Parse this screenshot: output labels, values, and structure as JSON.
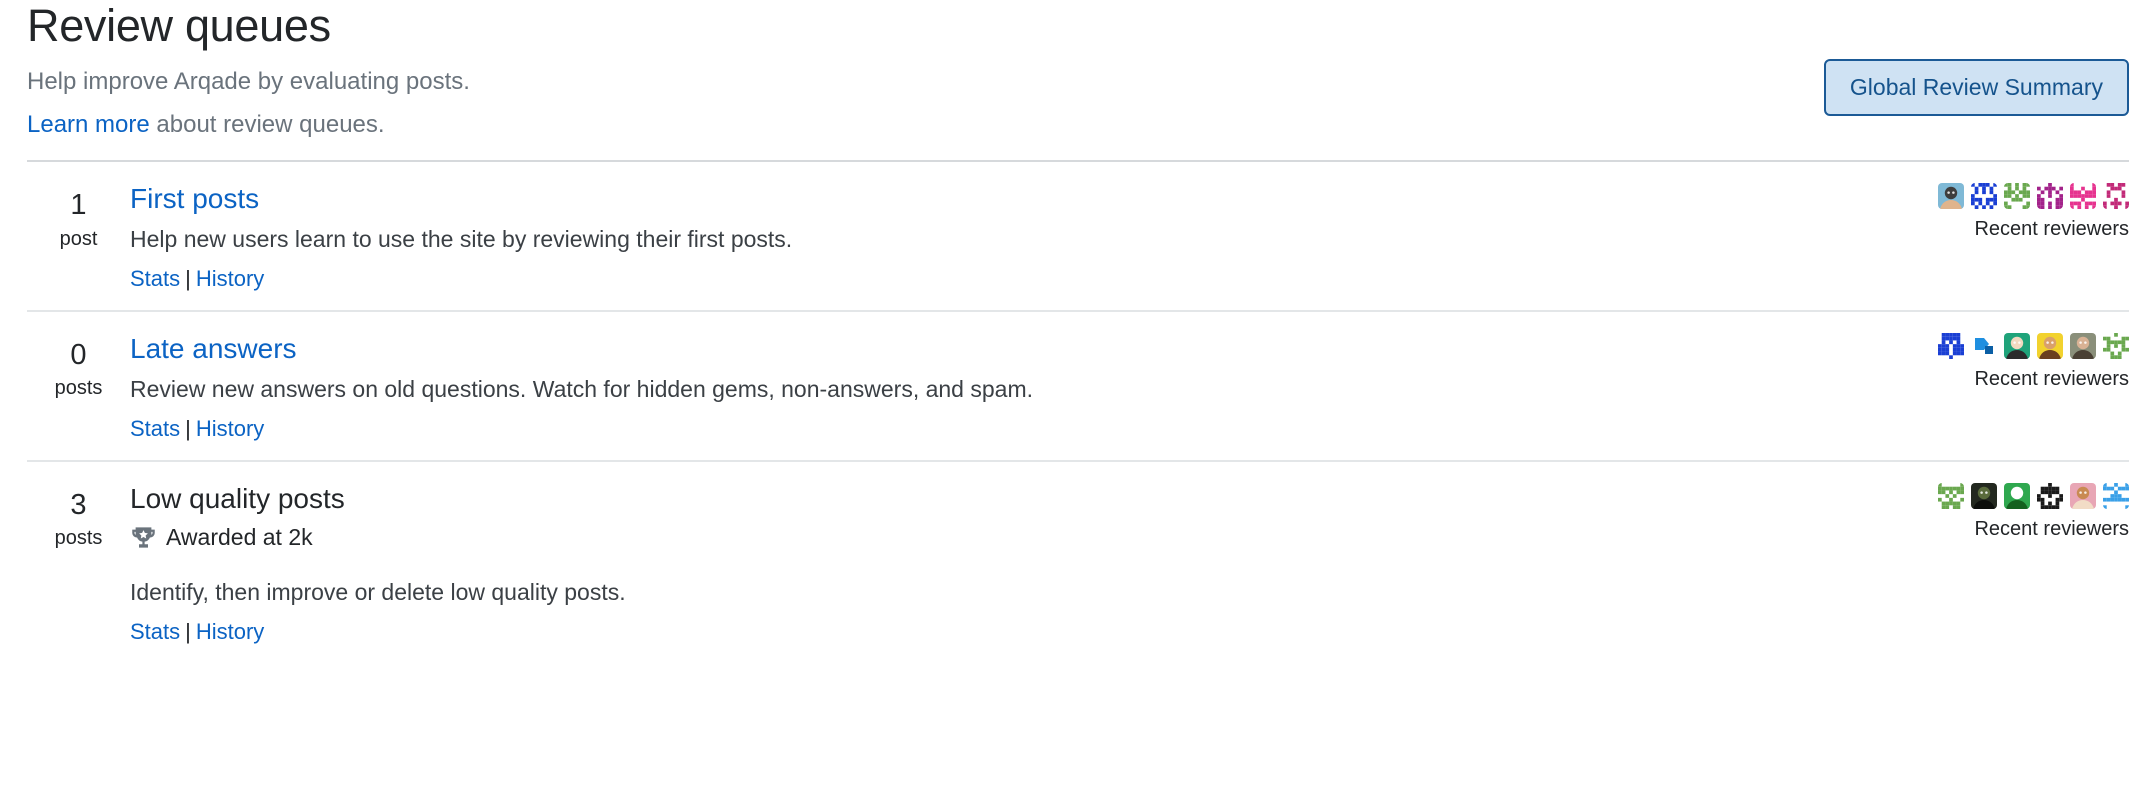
{
  "header": {
    "title": "Review queues",
    "subtitle": "Help improve Arqade by evaluating posts.",
    "learn_more_link": "Learn more",
    "learn_more_rest": " about review queues.",
    "summary_button": "Global Review Summary"
  },
  "colors": {
    "link_blue": "#0b63c4",
    "button_bg": "#cfe2f3",
    "button_border": "#1b5a96",
    "button_text": "#15538c",
    "muted_text": "#6a737c",
    "body_text": "#232629",
    "divider": "#d6d9dc",
    "trophy": "#6a737c"
  },
  "reviewers_label": "Recent reviewers",
  "links": {
    "stats": "Stats",
    "separator": "|",
    "history": "History"
  },
  "queues": [
    {
      "count": "1",
      "count_label": "post",
      "title": "First posts",
      "locked": false,
      "awarded": null,
      "description": "Help new users learn to use the site by reviewing their first posts.",
      "reviewers": [
        {
          "name": "reviewer-avatar-photo-glasses",
          "type": "photo",
          "colors": [
            "#7fb9d6",
            "#3d3d3d",
            "#e0b48c",
            "#8c6239"
          ]
        },
        {
          "name": "reviewer-avatar-identicon-blue",
          "type": "identicon",
          "colors": [
            "#1a3fd4",
            "#ffffff"
          ]
        },
        {
          "name": "reviewer-avatar-identicon-green",
          "type": "identicon",
          "colors": [
            "#6aa84f",
            "#ffffff"
          ]
        },
        {
          "name": "reviewer-avatar-identicon-purple",
          "type": "identicon",
          "colors": [
            "#a3228a",
            "#ffffff"
          ]
        },
        {
          "name": "reviewer-avatar-identicon-pink",
          "type": "identicon",
          "colors": [
            "#e6338f",
            "#ffffff"
          ]
        },
        {
          "name": "reviewer-avatar-identicon-magenta",
          "type": "identicon",
          "colors": [
            "#c22a78",
            "#ffffff"
          ]
        }
      ]
    },
    {
      "count": "0",
      "count_label": "posts",
      "title": "Late answers",
      "locked": false,
      "awarded": null,
      "description": "Review new answers on old questions. Watch for hidden gems, non-answers, and spam.",
      "reviewers": [
        {
          "name": "reviewer-avatar-identicon-blue-2",
          "type": "identicon",
          "colors": [
            "#1a3fd4",
            "#ffffff"
          ]
        },
        {
          "name": "reviewer-avatar-blue-shape",
          "type": "shape",
          "colors": [
            "#1f8fe0",
            "#0b5fa5"
          ]
        },
        {
          "name": "reviewer-avatar-anime-green-hair",
          "type": "photo",
          "colors": [
            "#1fa37a",
            "#f2d9c0",
            "#2b2b2b"
          ]
        },
        {
          "name": "reviewer-avatar-yellow-hair",
          "type": "photo",
          "colors": [
            "#f2d22e",
            "#d9a06b",
            "#6b3f1f"
          ]
        },
        {
          "name": "reviewer-avatar-man-beard",
          "type": "photo",
          "colors": [
            "#8a8f7a",
            "#d9b294",
            "#4a4034"
          ]
        },
        {
          "name": "reviewer-avatar-identicon-green-2",
          "type": "identicon",
          "colors": [
            "#6aa84f",
            "#ffffff"
          ]
        }
      ]
    },
    {
      "count": "3",
      "count_label": "posts",
      "title": "Low quality posts",
      "locked": true,
      "awarded": "Awarded at 2k",
      "description": "Identify, then improve or delete low quality posts.",
      "reviewers": [
        {
          "name": "reviewer-avatar-identicon-green-3",
          "type": "identicon",
          "colors": [
            "#6aa84f",
            "#ffffff"
          ]
        },
        {
          "name": "reviewer-avatar-dark-dragon",
          "type": "photo",
          "colors": [
            "#23281f",
            "#5a6b3c",
            "#0d0f0c"
          ]
        },
        {
          "name": "reviewer-avatar-green-creature",
          "type": "photo",
          "colors": [
            "#2fa84f",
            "#ffffff",
            "#14611f"
          ]
        },
        {
          "name": "reviewer-avatar-identicon-black",
          "type": "identicon",
          "colors": [
            "#1a1a1a",
            "#ffffff"
          ]
        },
        {
          "name": "reviewer-avatar-anime-pink-scarf",
          "type": "photo",
          "colors": [
            "#e8a6b5",
            "#c98a52",
            "#f2dcc6"
          ]
        },
        {
          "name": "reviewer-avatar-identicon-lightblue",
          "type": "identicon",
          "colors": [
            "#3aa0e8",
            "#ffffff"
          ]
        }
      ]
    }
  ]
}
